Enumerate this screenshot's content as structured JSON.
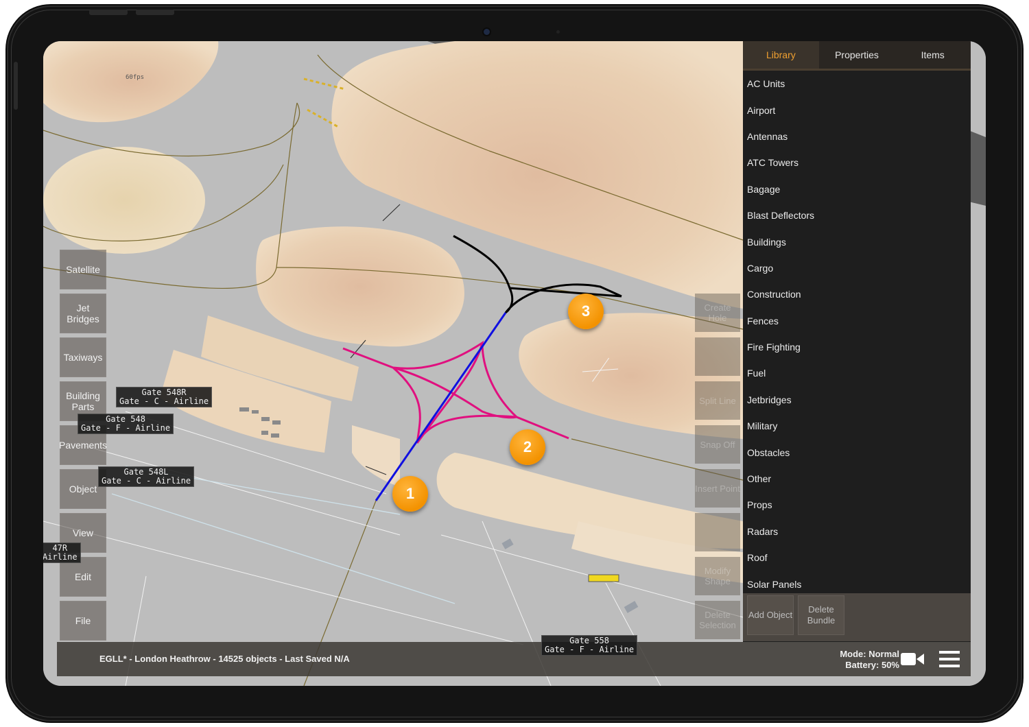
{
  "app": {
    "fps": "60fps"
  },
  "left_menu": {
    "items": [
      {
        "label": "Satellite"
      },
      {
        "label": "Jet Bridges"
      },
      {
        "label": "Taxiways"
      },
      {
        "label": "Building Parts"
      },
      {
        "label": "Pavements"
      },
      {
        "label": "Object"
      },
      {
        "label": "View"
      },
      {
        "label": "Edit"
      },
      {
        "label": "File"
      }
    ]
  },
  "tools": {
    "items": [
      {
        "label": "Create Hole"
      },
      {
        "label": ""
      },
      {
        "label": "Split Line"
      },
      {
        "label": "Snap Off"
      },
      {
        "label": "Insert Point"
      },
      {
        "label": ""
      },
      {
        "label": "Modify Shape"
      },
      {
        "label": "Delete Selection"
      }
    ]
  },
  "gate_labels": [
    {
      "line1": "Gate 548R",
      "line2": "Gate - C - Airline"
    },
    {
      "line1": "Gate 548",
      "line2": "Gate - F - Airline"
    },
    {
      "line1": "Gate 548L",
      "line2": "Gate - C - Airline"
    },
    {
      "line1": "47R",
      "line2": "Airline"
    },
    {
      "line1": "Gate 558",
      "line2": "Gate - F - Airline"
    }
  ],
  "markers": [
    {
      "label": "1"
    },
    {
      "label": "2"
    },
    {
      "label": "3"
    }
  ],
  "panel": {
    "tabs": [
      {
        "label": "Library",
        "active": true
      },
      {
        "label": "Properties",
        "active": false
      },
      {
        "label": "Items",
        "active": false
      }
    ],
    "library": [
      "AC Units",
      "Airport",
      "Antennas",
      "ATC Towers",
      "Bagage",
      "Blast Deflectors",
      "Buildings",
      "Cargo",
      "Construction",
      "Fences",
      "Fire Fighting",
      "Fuel",
      "Jetbridges",
      "Military",
      "Obstacles",
      "Other",
      "Props",
      "Radars",
      "Roof",
      "Solar Panels"
    ],
    "actions": {
      "add_object": "Add Object",
      "delete_bundle": "Delete Bundle"
    }
  },
  "status": {
    "text": "EGLL* - London Heathrow - 14525 objects - Last Saved N/A",
    "mode": "Mode: Normal",
    "battery": "Battery: 50%"
  },
  "colors": {
    "accent": "#f0a030",
    "marker": "#f39200",
    "line_blue": "#1010e0",
    "line_magenta": "#e0107f",
    "line_black": "#000000",
    "grass": "#e8c9a6",
    "tarmac": "#b9b9b9"
  }
}
